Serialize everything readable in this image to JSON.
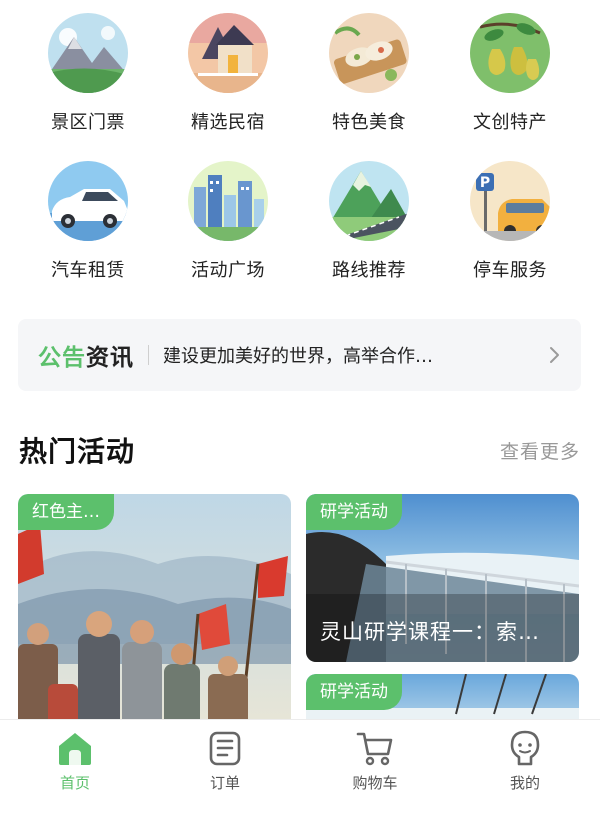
{
  "categories": [
    {
      "label": "景区门票",
      "icon": "mountain-scenery-icon"
    },
    {
      "label": "精选民宿",
      "icon": "house-icon"
    },
    {
      "label": "特色美食",
      "icon": "food-icon"
    },
    {
      "label": "文创特产",
      "icon": "pear-icon"
    },
    {
      "label": "汽车租赁",
      "icon": "car-icon"
    },
    {
      "label": "活动广场",
      "icon": "city-buildings-icon"
    },
    {
      "label": "路线推荐",
      "icon": "mountain-road-icon"
    },
    {
      "label": "停车服务",
      "icon": "parking-icon"
    }
  ],
  "notice": {
    "brand_green": "公告",
    "brand_dark": "资讯",
    "text": "建设更加美好的世界，高举合作…"
  },
  "section": {
    "title": "热门活动",
    "more": "查看更多"
  },
  "activities": [
    {
      "tag": "红色主…",
      "caption": ""
    },
    {
      "tag": "研学活动",
      "caption": "灵山研学课程一：索…"
    },
    {
      "tag": "研学活动",
      "caption": ""
    }
  ],
  "tabbar": {
    "items": [
      {
        "label": "首页",
        "icon": "home-icon",
        "active": true
      },
      {
        "label": "订单",
        "icon": "order-icon",
        "active": false
      },
      {
        "label": "购物车",
        "icon": "cart-icon",
        "active": false
      },
      {
        "label": "我的",
        "icon": "profile-icon",
        "active": false
      }
    ]
  },
  "colors": {
    "accent": "#5cc06c",
    "text_primary": "#222222",
    "text_muted": "#999999",
    "notice_bg": "#f5f6f8"
  }
}
